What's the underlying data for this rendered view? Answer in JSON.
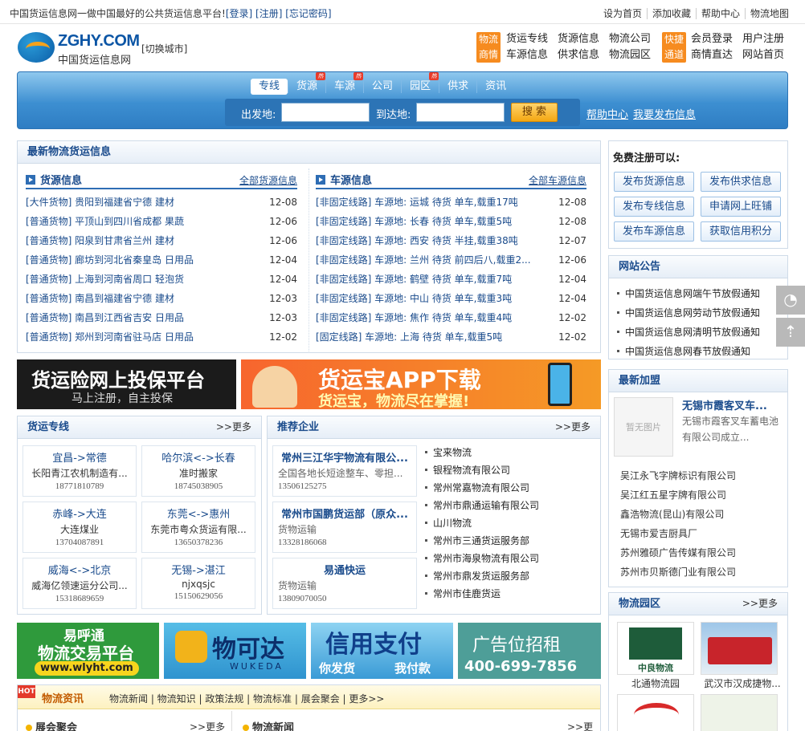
{
  "topbar": {
    "msg": "中国货运信息网一做中国最好的公共货运信息平台!",
    "login": "[登录]",
    "register": "[注册]",
    "forgot": "[忘记密码]",
    "links": [
      "设为首页",
      "添加收藏",
      "帮助中心",
      "物流地图"
    ]
  },
  "header": {
    "logo_en": "ZGHY.COM",
    "logo_cn": "中国货运信息网",
    "switch_city": "[切换城市]",
    "tag1": [
      "物流",
      "商情"
    ],
    "links1": [
      [
        "货运专线",
        "货源信息",
        "物流公司"
      ],
      [
        "车源信息",
        "供求信息",
        "物流园区"
      ]
    ],
    "tag2": [
      "快捷",
      "通道"
    ],
    "links2": [
      [
        "会员登录",
        "用户注册"
      ],
      [
        "商情直达",
        "网站首页"
      ]
    ]
  },
  "nav": {
    "items": [
      {
        "label": "专线",
        "hot": ""
      },
      {
        "label": "货源",
        "hot": "热"
      },
      {
        "label": "车源",
        "hot": "热"
      },
      {
        "label": "公司",
        "hot": ""
      },
      {
        "label": "园区",
        "hot": "热"
      },
      {
        "label": "供求",
        "hot": ""
      },
      {
        "label": "资讯",
        "hot": ""
      }
    ],
    "from_label": "出发地:",
    "to_label": "到达地:",
    "search_btn": "搜 索",
    "help": "帮助中心",
    "publish": "我要发布信息"
  },
  "latest": {
    "title": "最新物流货运信息",
    "goods_title": "货源信息",
    "goods_more": "全部货源信息",
    "vehicle_title": "车源信息",
    "vehicle_more": "全部车源信息",
    "goods": [
      [
        "[大件货物] 贵阳到福建省宁德  建材",
        "12-08"
      ],
      [
        "[普通货物] 平顶山到四川省成都  果蔬",
        "12-06"
      ],
      [
        "[普通货物] 阳泉到甘肃省兰州  建材",
        "12-06"
      ],
      [
        "[普通货物] 廊坊到河北省秦皇岛  日用品",
        "12-04"
      ],
      [
        "[普通货物] 上海到河南省周口  轻泡货",
        "12-04"
      ],
      [
        "[普通货物] 南昌到福建省宁德  建材",
        "12-03"
      ],
      [
        "[普通货物] 南昌到江西省吉安  日用品",
        "12-03"
      ],
      [
        "[普通货物] 郑州到河南省驻马店  日用品",
        "12-02"
      ]
    ],
    "vehicles": [
      [
        "[非固定线路] 车源地: 运城  待货  单车,载重17吨",
        "12-08"
      ],
      [
        "[非固定线路] 车源地: 长春  待货  单车,载重5吨",
        "12-08"
      ],
      [
        "[非固定线路] 车源地: 西安  待货  半挂,载重38吨",
        "12-07"
      ],
      [
        "[非固定线路] 车源地: 兰州  待货  前四后八,载重2...",
        "12-06"
      ],
      [
        "[非固定线路] 车源地: 鹤壁  待货  单车,载重7吨",
        "12-04"
      ],
      [
        "[非固定线路] 车源地: 中山  待货  单车,载重3吨",
        "12-04"
      ],
      [
        "[非固定线路] 车源地: 焦作  待货  单车,载重4吨",
        "12-02"
      ],
      [
        "[固定线路] 车源地: 上海  待货  单车,载重5吨",
        "12-02"
      ]
    ]
  },
  "free": {
    "title": "免费注册可以:",
    "buttons": [
      "发布货源信息",
      "发布供求信息",
      "发布专线信息",
      "申请网上旺铺",
      "发布车源信息",
      "获取信用积分"
    ]
  },
  "notice": {
    "title": "网站公告",
    "items": [
      "中国货运信息网端午节放假通知",
      "中国货运信息网劳动节放假通知",
      "中国货运信息网清明节放假通知",
      "中国货运信息网春节放假通知"
    ]
  },
  "ads1": {
    "left_big": "货运险网上投保平台",
    "left_small": "马上注册，自主投保",
    "right_big": "货运宝APP下载",
    "right_small": "货运宝，物流尽在掌握!"
  },
  "newjoin": {
    "title": "最新加盟",
    "noimg": "暂无图片",
    "featured_name": "无锡市霞客叉车...",
    "featured_desc": "无锡市霞客叉车蓄电池有限公司成立...",
    "items": [
      "吴江永飞字牌标识有限公司",
      "吴江红五星字牌有限公司",
      "鑫浩物流(昆山)有限公司",
      "无锡市爱吉厨具厂",
      "苏州雅硕广告传媒有限公司",
      "苏州市贝斯德门业有限公司"
    ]
  },
  "lines": {
    "title": "货运专线",
    "more": ">>更多",
    "items": [
      [
        "宜昌->常德",
        "长阳青江农机制造有...",
        "18771810789"
      ],
      [
        "哈尔滨<->长春",
        "准时搬家",
        "18745038905"
      ],
      [
        "赤峰->大连",
        "大连煤业",
        "13704087891"
      ],
      [
        "东莞<->惠州",
        "东莞市粤众货运有限...",
        "13650378236"
      ],
      [
        "威海<->北京",
        "威海亿领速运分公司...",
        "15318689659"
      ],
      [
        "无锡->湛江",
        "njxqsjc",
        "15150629056"
      ]
    ]
  },
  "companies": {
    "title": "推荐企业",
    "more": ">>更多",
    "featured": [
      [
        "常州三江华宇物流有限公...",
        "全国各地长短途整车、零担...",
        "13506125275"
      ],
      [
        "常州市国鹏货运部（原众...",
        "货物运输",
        "13328186068"
      ],
      [
        "易通快运",
        "货物运输",
        "13809070050"
      ]
    ],
    "list": [
      "宝来物流",
      "银程物流有限公司",
      "常州常嘉物流有限公司",
      "常州市鼎通运输有限公司",
      "山川物流",
      "常州市三通货运服务部",
      "常州市海泉物流有限公司",
      "常州市鼎发货运服务部",
      "常州市佳鹿货运"
    ]
  },
  "park": {
    "title": "物流园区",
    "more": ">>更多",
    "items": [
      "北通物流园",
      "武汉市汉成捷物...",
      "中良物流"
    ]
  },
  "ads2": {
    "a1": "易呼通",
    "a2": "物流交易平台",
    "a3": "www.wlyht.com",
    "b1": "物可达",
    "b2": "WUKEDA",
    "c1": "信用支付",
    "c2": "你发货",
    "c3": "我付款",
    "d1": "广告位招租",
    "d2": "400-699-7856"
  },
  "news": {
    "title": "物流资讯",
    "links": "物流新闻 | 物流知识 | 政策法规 | 物流标准 | 展会聚会 | 更多>>",
    "hot": "HOT",
    "left_title": "展会聚会",
    "left_more": ">>更多",
    "right_title": "物流新闻",
    "right_more": ">>更多"
  },
  "colors": {
    "accent": "#2e6db4",
    "orange": "#f68b1f",
    "title": "#1a4b8c"
  }
}
